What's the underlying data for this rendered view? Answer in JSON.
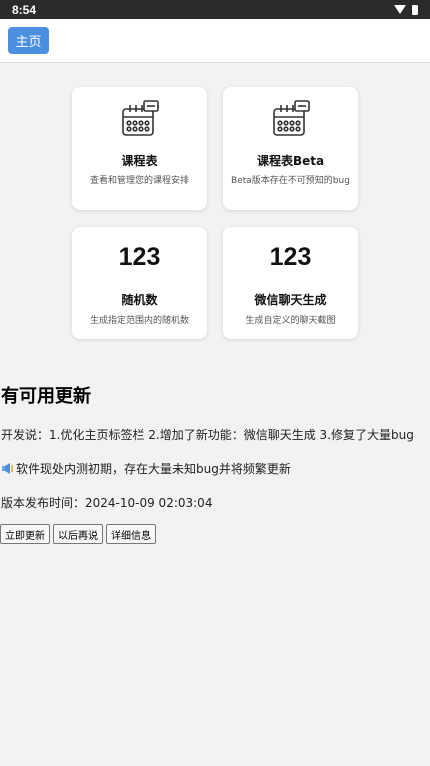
{
  "status_bar": {
    "time": "8:54"
  },
  "header": {
    "home_label": "主页"
  },
  "cards": [
    {
      "title": "课程表",
      "desc": "查看和管理您的课程安排",
      "icon": "calendar-icon"
    },
    {
      "title": "课程表Beta",
      "desc": "Beta版本存在不可预知的bug",
      "icon": "calendar-icon"
    },
    {
      "number": "123",
      "title": "随机数",
      "desc": "生成指定范围内的随机数"
    },
    {
      "number": "123",
      "title": "微信聊天生成",
      "desc": "生成自定义的聊天截图"
    }
  ],
  "update": {
    "title": "有可用更新",
    "notes": "开发说：1.优化主页标签栏 2.增加了新功能：微信聊天生成 3.修复了大量bug",
    "warning": "软件现处内测初期，存在大量未知bug并将频繁更新",
    "release_time": "版本发布时间：2024-10-09 02:03:04",
    "buttons": {
      "update_now": "立即更新",
      "later": "以后再说",
      "details": "详细信息"
    }
  },
  "colors": {
    "accent": "#4b8fe0",
    "status_bar": "#2b2b2b",
    "background": "#f2f2f2"
  }
}
